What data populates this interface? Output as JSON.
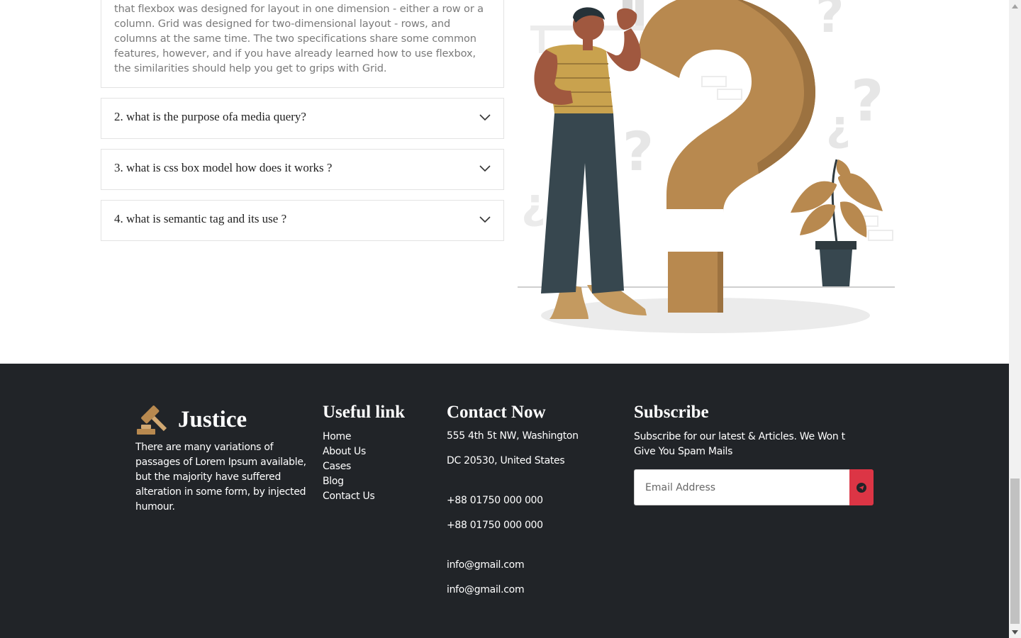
{
  "faq": {
    "open_answer": "that flexbox was designed for layout in one dimension - either a row or a column. Grid was designed for two-dimensional layout - rows, and columns at the same time. The two specifications share some common features, however, and if you have already learned how to use flexbox, the similarities should help you get to grips with Grid.",
    "items": [
      {
        "question": "2. what is the purpose ofa media query?"
      },
      {
        "question": "3. what is css box model how does it works ?"
      },
      {
        "question": "4. what is semantic tag and its use ?"
      }
    ]
  },
  "footer": {
    "brand": {
      "name": "Justice",
      "logo_icon": "gavel-icon",
      "description": "There are many variations of passages of Lorem Ipsum available, but the majority have suffered alteration in some form, by injected humour."
    },
    "useful_links": {
      "title": "Useful link",
      "items": [
        "Home",
        "About Us",
        "Cases",
        "Blog",
        "Contact Us"
      ]
    },
    "contact": {
      "title": "Contact Now",
      "address_line1": "555 4th 5t NW, Washington",
      "address_line2": "DC 20530, United States",
      "phone1": "+88 01750 000 000",
      "phone2": "+88 01750 000 000",
      "email1": "info@gmail.com",
      "email2": "info@gmail.com"
    },
    "subscribe": {
      "title": "Subscribe",
      "description": "Subscribe for our latest & Articles. We Won t Give You Spam Mails",
      "placeholder": "Email Address",
      "button_icon": "send-icon"
    }
  },
  "colors": {
    "footer_bg": "#212428",
    "accent_gold": "#b8894f",
    "button_red": "#dc3545"
  }
}
